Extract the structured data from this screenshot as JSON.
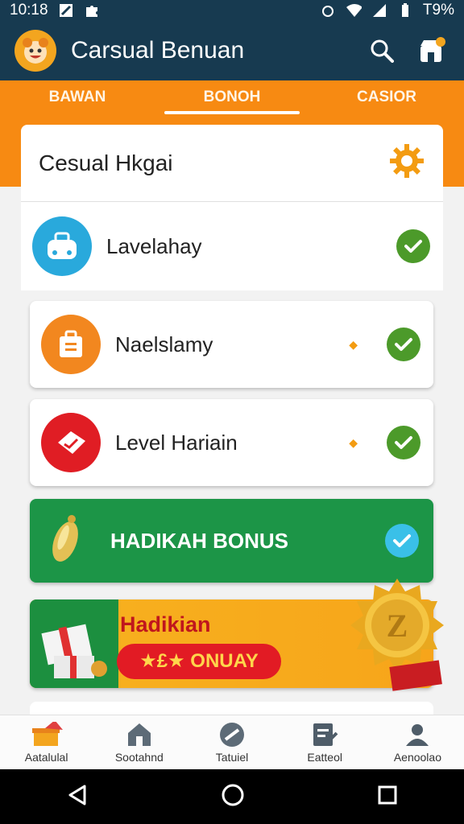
{
  "status_bar": {
    "time": "10:18",
    "battery": "T9%"
  },
  "app": {
    "title": "Carsual Benuan"
  },
  "tabs": [
    {
      "label": "BAWAN",
      "active": false
    },
    {
      "label": "BONOH",
      "active": true
    },
    {
      "label": "CASIOR",
      "active": false
    }
  ],
  "header": {
    "title": "Cesual Hkgai"
  },
  "items": [
    {
      "label": "Lavelahay",
      "icon": "bag-icon",
      "color": "#29a9dc",
      "checked": true
    },
    {
      "label": "Naelslamy",
      "icon": "briefcase-icon",
      "color": "#f2871f",
      "checked": true
    },
    {
      "label": "Level Hariain",
      "icon": "ticket-icon",
      "color": "#e01d24",
      "checked": true
    }
  ],
  "bonus": {
    "label": "HADIKAH BONUS"
  },
  "promo": {
    "title": "Hadikian",
    "pill": "★£★ ONUAY"
  },
  "bottom_nav": [
    {
      "label": "Aatalulal",
      "icon": "gift-icon"
    },
    {
      "label": "Sootahnd",
      "icon": "home-icon"
    },
    {
      "label": "Tatuiel",
      "icon": "compass-icon"
    },
    {
      "label": "Eatteol",
      "icon": "edit-icon"
    },
    {
      "label": "Aenoolao",
      "icon": "profile-icon"
    }
  ],
  "colors": {
    "header_bg": "#173a50",
    "accent_orange": "#f78a12",
    "check_green": "#4c9a2a",
    "bonus_green": "#1c9547",
    "promo_gold": "#f7b21f"
  }
}
